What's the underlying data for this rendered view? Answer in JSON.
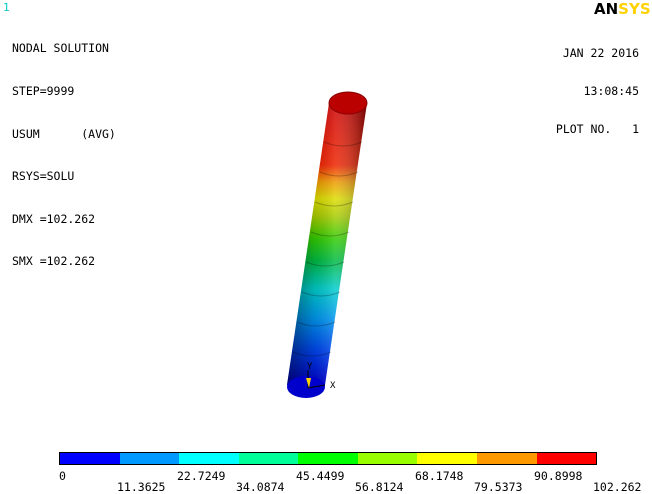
{
  "window_number": "1",
  "info_lines": [
    "NODAL SOLUTION",
    "STEP=9999",
    "USUM      (AVG)",
    "RSYS=SOLU",
    "DMX =102.262",
    "SMX =102.262"
  ],
  "brand": {
    "part1": "AN",
    "part2": "SYS",
    "color1": "#000000",
    "color2": "#ffd200"
  },
  "date": "JAN 22 2016",
  "time": "13:08:45",
  "plot_label": "PLOT NO.   1",
  "axis_triad": {
    "x_label": "X",
    "y_label": "Y"
  },
  "legend": {
    "colors": [
      "#0000ff",
      "#0099ff",
      "#00ffff",
      "#00ff99",
      "#00ff00",
      "#99ff00",
      "#ffff00",
      "#ff9900",
      "#ff0000"
    ],
    "labels": [
      "0",
      "11.3625",
      "22.7249",
      "34.0874",
      "45.4499",
      "56.8124",
      "68.1748",
      "79.5373",
      "90.8998",
      "102.262"
    ]
  }
}
